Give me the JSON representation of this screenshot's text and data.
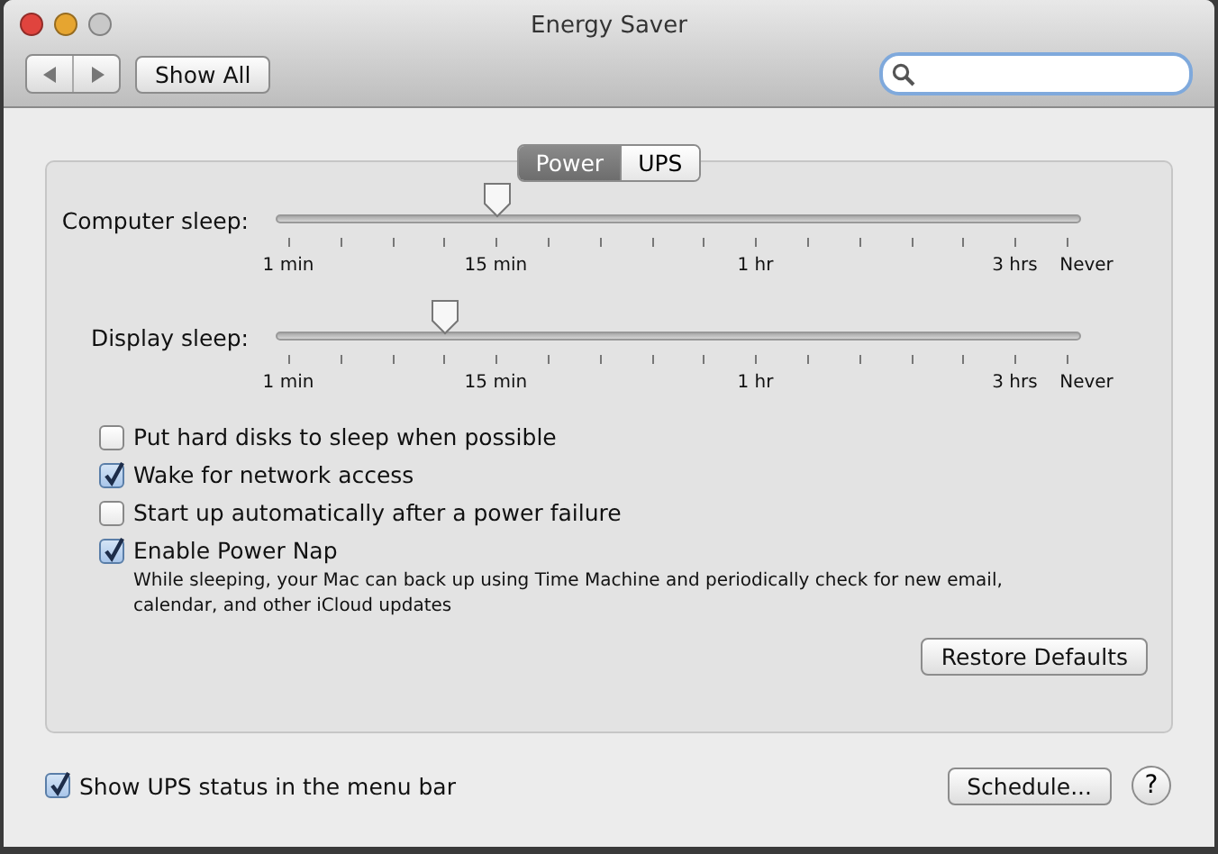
{
  "window": {
    "title": "Energy Saver"
  },
  "toolbar": {
    "show_all": "Show All"
  },
  "tabs": [
    {
      "label": "Power",
      "selected": true
    },
    {
      "label": "UPS",
      "selected": false
    }
  ],
  "sliders": [
    {
      "label": "Computer sleep:",
      "level": 0.276,
      "tick_labels": [
        "1 min",
        "15 min",
        "1 hr",
        "3 hrs",
        "Never"
      ]
    },
    {
      "label": "Display sleep:",
      "level": 0.21,
      "tick_labels": [
        "1 min",
        "15 min",
        "1 hr",
        "3 hrs",
        "Never"
      ]
    }
  ],
  "options": [
    {
      "label": "Put hard disks to sleep when possible",
      "checked": false
    },
    {
      "label": "Wake for network access",
      "checked": true
    },
    {
      "label": "Start up automatically after a power failure",
      "checked": false
    },
    {
      "label": "Enable Power Nap",
      "checked": true,
      "description": "While sleeping, your Mac can back up using Time Machine and periodically check for new email, calendar, and other iCloud updates"
    }
  ],
  "restore_defaults": "Restore Defaults",
  "footer": {
    "ups_status": {
      "label": "Show UPS status in the menu bar",
      "checked": true
    },
    "schedule": "Schedule...",
    "help": "?"
  }
}
